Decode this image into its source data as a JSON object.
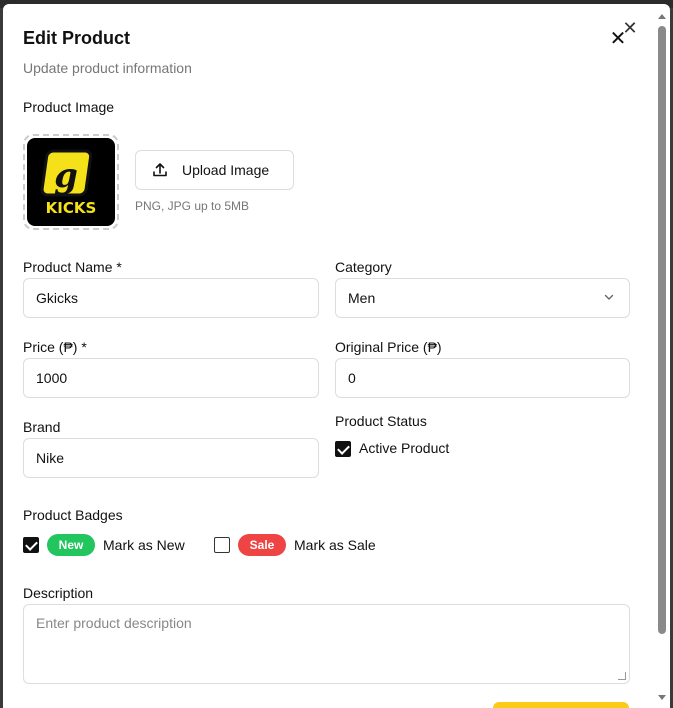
{
  "dialog": {
    "title": "Edit Product",
    "subtitle": "Update product information",
    "close_icon": "close-icon"
  },
  "image": {
    "label": "Product Image",
    "logo_text": "KICKS",
    "logo_letter": "G",
    "upload_label": "Upload Image",
    "upload_icon": "upload-icon",
    "hint": "PNG, JPG up to 5MB"
  },
  "fields": {
    "name_label": "Product Name *",
    "name_value": "Gkicks",
    "category_label": "Category",
    "category_value": "Men",
    "price_label": "Price (₱) *",
    "price_value": "1000",
    "original_price_label": "Original Price (₱)",
    "original_price_value": "0",
    "brand_label": "Brand",
    "brand_value": "Nike",
    "status_label": "Product Status",
    "active_label": "Active Product",
    "active_checked": true
  },
  "badges": {
    "label": "Product Badges",
    "new_badge": "New",
    "new_label": "Mark as New",
    "new_checked": true,
    "sale_badge": "Sale",
    "sale_label": "Mark as Sale",
    "sale_checked": false,
    "new_color": "#22c55e",
    "sale_color": "#ef4444"
  },
  "description": {
    "label": "Description",
    "placeholder": "Enter product description"
  }
}
